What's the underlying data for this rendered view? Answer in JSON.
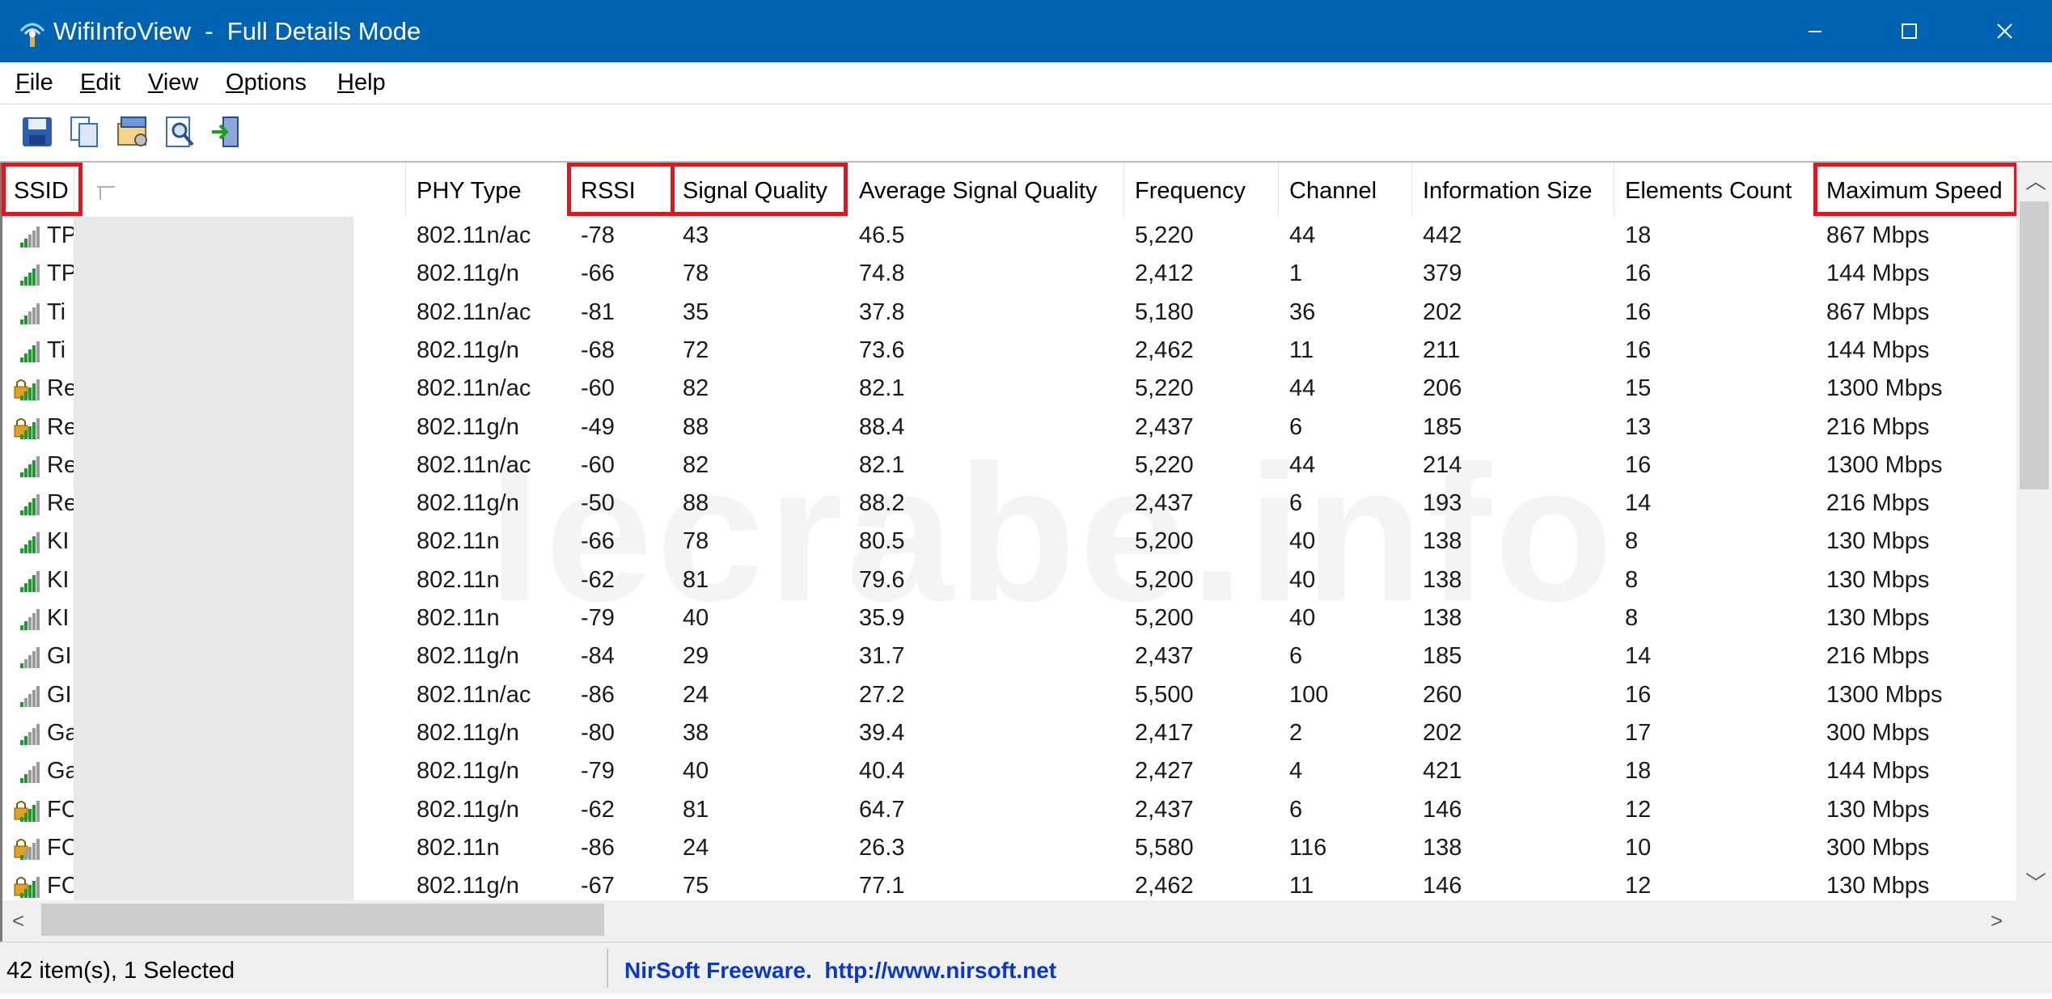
{
  "window": {
    "title": "WifiInfoView  -  Full Details Mode",
    "accent": "#0063b1"
  },
  "menu": [
    "File",
    "Edit",
    "View",
    "Options",
    "Help"
  ],
  "toolbar": [
    "save-icon",
    "copy-icon",
    "properties-icon",
    "find-icon",
    "exit-icon"
  ],
  "columns": [
    {
      "key": "ssid",
      "label": "SSID",
      "highlighted": true
    },
    {
      "key": "mac",
      "label": "",
      "highlighted": false
    },
    {
      "key": "phy",
      "label": "PHY Type",
      "highlighted": false
    },
    {
      "key": "rssi",
      "label": "RSSI",
      "highlighted": true
    },
    {
      "key": "quality",
      "label": "Signal Quality",
      "highlighted": true
    },
    {
      "key": "avg",
      "label": "Average Signal Quality",
      "highlighted": false
    },
    {
      "key": "freq",
      "label": "Frequency",
      "highlighted": false
    },
    {
      "key": "channel",
      "label": "Channel",
      "highlighted": false
    },
    {
      "key": "infosize",
      "label": "Information Size",
      "highlighted": false
    },
    {
      "key": "elements",
      "label": "Elements Count",
      "highlighted": false
    },
    {
      "key": "speed",
      "label": "Maximum Speed",
      "highlighted": true
    }
  ],
  "rows": [
    {
      "icon": "signal-icon",
      "ssid": "TP",
      "phy": "802.11n/ac",
      "rssi": "-78",
      "quality": "43",
      "avg": "46.5",
      "freq": "5,220",
      "channel": "44",
      "infosize": "442",
      "elements": "18",
      "speed": "867 Mbps"
    },
    {
      "icon": "signal-icon",
      "ssid": "TP",
      "phy": "802.11g/n",
      "rssi": "-66",
      "quality": "78",
      "avg": "74.8",
      "freq": "2,412",
      "channel": "1",
      "infosize": "379",
      "elements": "16",
      "speed": "144 Mbps"
    },
    {
      "icon": "signal-icon",
      "ssid": "Ti",
      "phy": "802.11n/ac",
      "rssi": "-81",
      "quality": "35",
      "avg": "37.8",
      "freq": "5,180",
      "channel": "36",
      "infosize": "202",
      "elements": "16",
      "speed": "867 Mbps"
    },
    {
      "icon": "signal-icon",
      "ssid": "Ti",
      "phy": "802.11g/n",
      "rssi": "-68",
      "quality": "72",
      "avg": "73.6",
      "freq": "2,462",
      "channel": "11",
      "infosize": "211",
      "elements": "16",
      "speed": "144 Mbps"
    },
    {
      "icon": "lock-signal-icon",
      "ssid": "Re",
      "phy": "802.11n/ac",
      "rssi": "-60",
      "quality": "82",
      "avg": "82.1",
      "freq": "5,220",
      "channel": "44",
      "infosize": "206",
      "elements": "15",
      "speed": "1300 Mbps"
    },
    {
      "icon": "lock-signal-icon",
      "ssid": "Re",
      "phy": "802.11g/n",
      "rssi": "-49",
      "quality": "88",
      "avg": "88.4",
      "freq": "2,437",
      "channel": "6",
      "infosize": "185",
      "elements": "13",
      "speed": "216 Mbps"
    },
    {
      "icon": "signal-icon",
      "ssid": "Re",
      "phy": "802.11n/ac",
      "rssi": "-60",
      "quality": "82",
      "avg": "82.1",
      "freq": "5,220",
      "channel": "44",
      "infosize": "214",
      "elements": "16",
      "speed": "1300 Mbps"
    },
    {
      "icon": "signal-icon",
      "ssid": "Re",
      "phy": "802.11g/n",
      "rssi": "-50",
      "quality": "88",
      "avg": "88.2",
      "freq": "2,437",
      "channel": "6",
      "infosize": "193",
      "elements": "14",
      "speed": "216 Mbps"
    },
    {
      "icon": "signal-icon",
      "ssid": "KI",
      "phy": "802.11n",
      "rssi": "-66",
      "quality": "78",
      "avg": "80.5",
      "freq": "5,200",
      "channel": "40",
      "infosize": "138",
      "elements": "8",
      "speed": "130 Mbps"
    },
    {
      "icon": "signal-icon",
      "ssid": "KI",
      "phy": "802.11n",
      "rssi": "-62",
      "quality": "81",
      "avg": "79.6",
      "freq": "5,200",
      "channel": "40",
      "infosize": "138",
      "elements": "8",
      "speed": "130 Mbps"
    },
    {
      "icon": "signal-icon",
      "ssid": "KI",
      "phy": "802.11n",
      "rssi": "-79",
      "quality": "40",
      "avg": "35.9",
      "freq": "5,200",
      "channel": "40",
      "infosize": "138",
      "elements": "8",
      "speed": "130 Mbps"
    },
    {
      "icon": "signal-icon",
      "ssid": "GI",
      "phy": "802.11g/n",
      "rssi": "-84",
      "quality": "29",
      "avg": "31.7",
      "freq": "2,437",
      "channel": "6",
      "infosize": "185",
      "elements": "14",
      "speed": "216 Mbps"
    },
    {
      "icon": "signal-icon",
      "ssid": "GI",
      "phy": "802.11n/ac",
      "rssi": "-86",
      "quality": "24",
      "avg": "27.2",
      "freq": "5,500",
      "channel": "100",
      "infosize": "260",
      "elements": "16",
      "speed": "1300 Mbps"
    },
    {
      "icon": "signal-icon",
      "ssid": "Ga",
      "phy": "802.11g/n",
      "rssi": "-80",
      "quality": "38",
      "avg": "39.4",
      "freq": "2,417",
      "channel": "2",
      "infosize": "202",
      "elements": "17",
      "speed": "300 Mbps"
    },
    {
      "icon": "signal-icon",
      "ssid": "Ga",
      "phy": "802.11g/n",
      "rssi": "-79",
      "quality": "40",
      "avg": "40.4",
      "freq": "2,427",
      "channel": "4",
      "infosize": "421",
      "elements": "18",
      "speed": "144 Mbps"
    },
    {
      "icon": "lock-signal-icon",
      "ssid": "FC",
      "phy": "802.11g/n",
      "rssi": "-62",
      "quality": "81",
      "avg": "64.7",
      "freq": "2,437",
      "channel": "6",
      "infosize": "146",
      "elements": "12",
      "speed": "130 Mbps"
    },
    {
      "icon": "lock-signal-icon",
      "ssid": "FC",
      "phy": "802.11n",
      "rssi": "-86",
      "quality": "24",
      "avg": "26.3",
      "freq": "5,580",
      "channel": "116",
      "infosize": "138",
      "elements": "10",
      "speed": "300 Mbps"
    },
    {
      "icon": "lock-signal-icon",
      "ssid": "FC",
      "phy": "802.11g/n",
      "rssi": "-67",
      "quality": "75",
      "avg": "77.1",
      "freq": "2,462",
      "channel": "11",
      "infosize": "146",
      "elements": "12",
      "speed": "130 Mbps"
    }
  ],
  "watermark": "lecrabe.info",
  "status": {
    "items": "42 item(s), 1 Selected",
    "link": "NirSoft Freeware.  http://www.nirsoft.net"
  }
}
